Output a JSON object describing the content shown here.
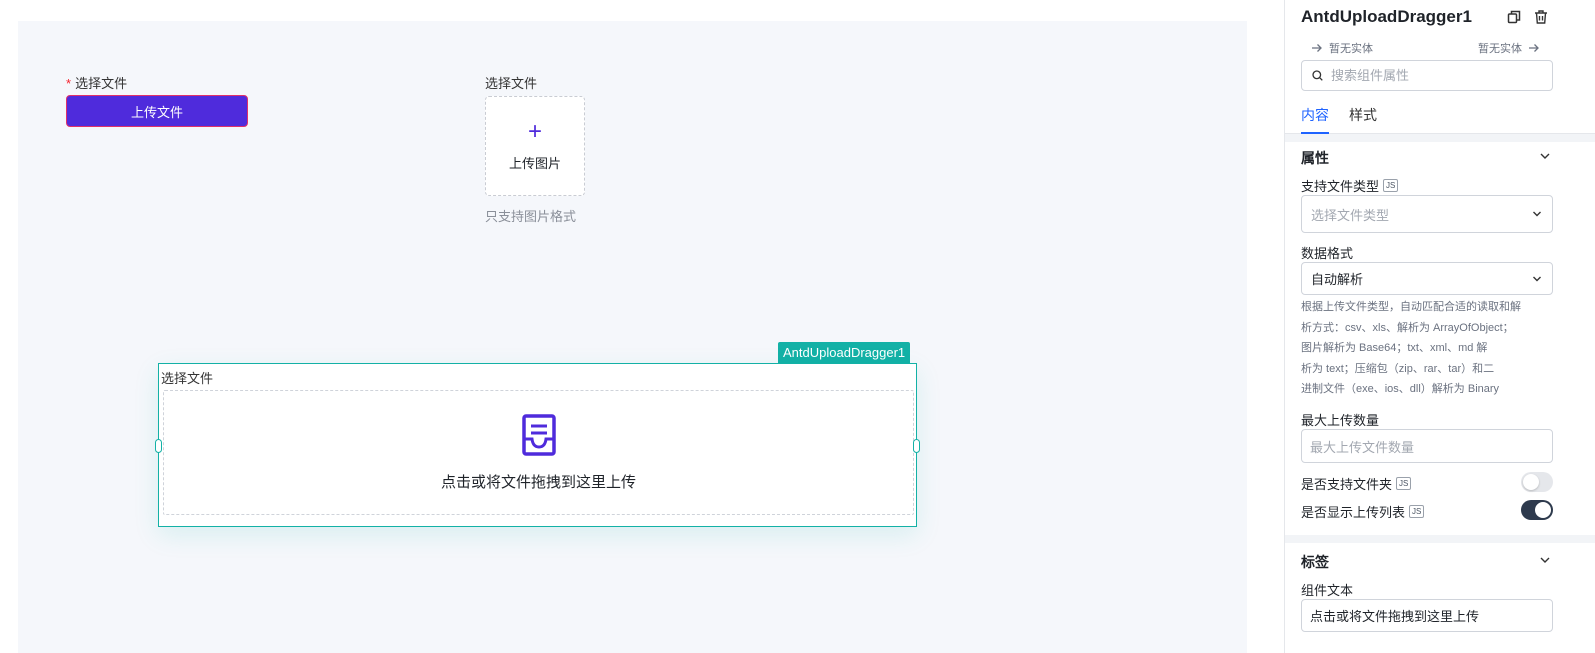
{
  "canvas": {
    "form_item1": {
      "label": "选择文件",
      "required_mark": "*",
      "button_label": "上传文件"
    },
    "form_item2": {
      "label": "选择文件",
      "upload_text": "上传图片",
      "plus": "+",
      "hint": "只支持图片格式"
    },
    "dragger": {
      "selection_tag": "AntdUploadDragger1",
      "label": "选择文件",
      "drop_text": "点击或将文件拖拽到这里上传",
      "icon": "inbox-icon"
    }
  },
  "panel": {
    "title": "AntdUploadDragger1",
    "prev_label": "暂无实体",
    "next_label": "暂无实体",
    "search_placeholder": "搜索组件属性",
    "tabs": [
      "内容",
      "样式"
    ],
    "properties": {
      "section_title": "属性",
      "file_type": {
        "label": "支持文件类型",
        "js": "JS",
        "placeholder": "选择文件类型"
      },
      "data_format": {
        "label": "数据格式",
        "value": "自动解析"
      },
      "description": [
        "根据上传文件类型，自动匹配合适的读取和解",
        "析方式：csv、xls、解析为 ArrayOfObject；",
        "图片解析为 Base64；txt、xml、md 解",
        "析为 text；压缩包（zip、rar、tar）和二",
        "进制文件（exe、ios、dll）解析为 Binary"
      ],
      "max_count": {
        "label": "最大上传数量",
        "placeholder": "最大上传文件数量"
      },
      "folder_support": {
        "label": "是否支持文件夹",
        "js": "JS",
        "enabled": false
      },
      "show_list": {
        "label": "是否显示上传列表",
        "js": "JS",
        "enabled": true
      }
    },
    "label_section": {
      "section_title": "标签",
      "component_text": {
        "label": "组件文本",
        "value": "点击或将文件拖拽到这里上传"
      }
    }
  },
  "colors": {
    "primary": "#4f2bdc",
    "selection": "#13b1a6",
    "tab_active": "#1f63ff"
  }
}
